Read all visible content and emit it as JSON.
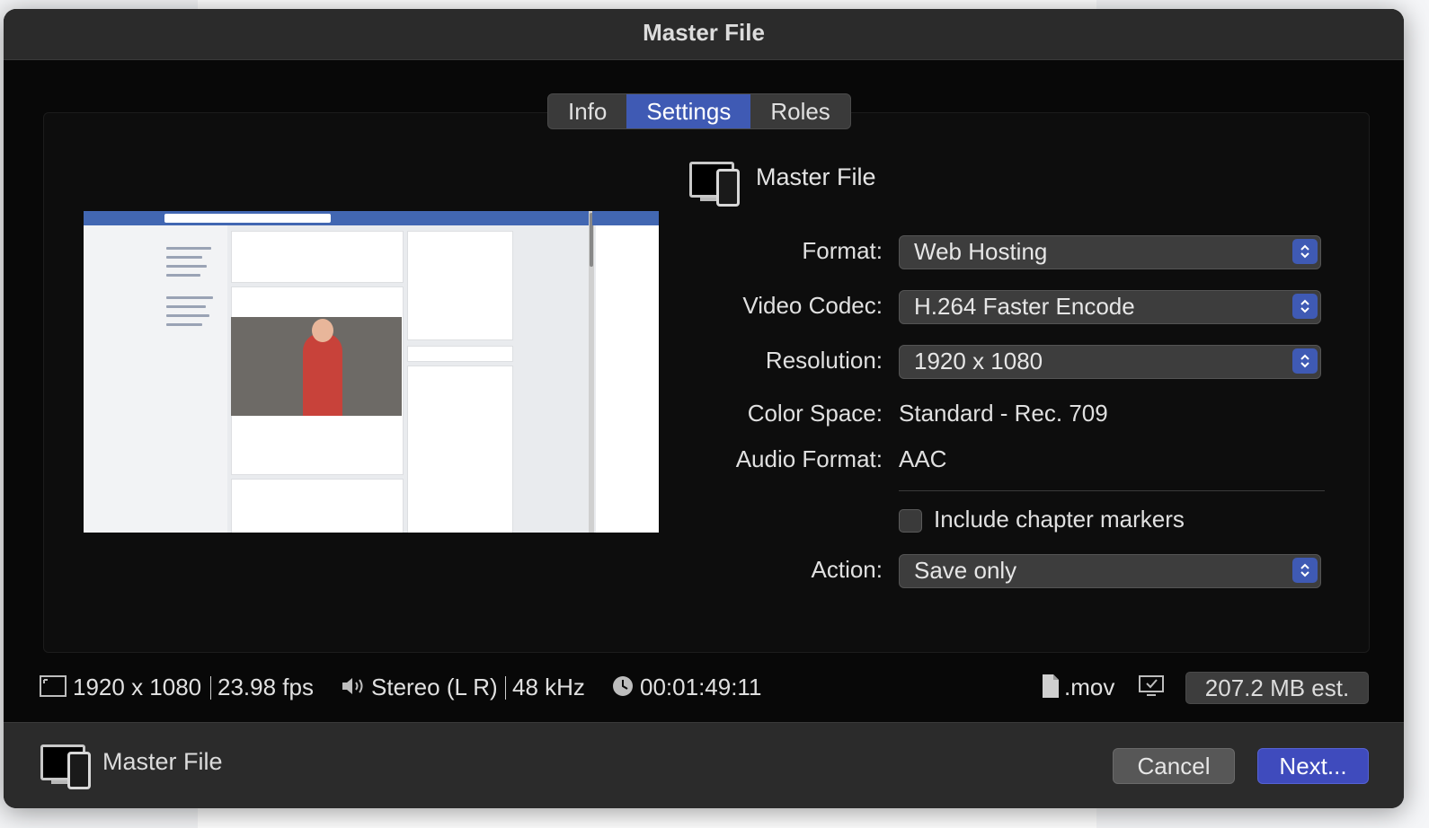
{
  "dialog": {
    "title": "Master File"
  },
  "tabs": [
    {
      "label": "Info",
      "active": false
    },
    {
      "label": "Settings",
      "active": true
    },
    {
      "label": "Roles",
      "active": false
    }
  ],
  "preset": {
    "name": "Master File",
    "icon": "computer-and-phone-icon"
  },
  "settings": {
    "format": {
      "label": "Format:",
      "value": "Web Hosting"
    },
    "video_codec": {
      "label": "Video Codec:",
      "value": "H.264 Faster Encode"
    },
    "resolution": {
      "label": "Resolution:",
      "value": "1920 x 1080"
    },
    "color_space": {
      "label": "Color Space:",
      "value": "Standard - Rec. 709"
    },
    "audio_format": {
      "label": "Audio Format:",
      "value": "AAC"
    },
    "chapter_markers": {
      "label": "Include chapter markers",
      "checked": false
    },
    "action": {
      "label": "Action:",
      "value": "Save only"
    }
  },
  "info_bar": {
    "frame_size": "1920 x 1080",
    "frame_rate": "23.98 fps",
    "audio_channels": "Stereo (L R)",
    "sample_rate": "48 kHz",
    "duration": "00:01:49:11",
    "extension": ".mov",
    "estimated_size": "207.2 MB est."
  },
  "footer": {
    "preset_name": "Master File",
    "cancel_label": "Cancel",
    "next_label": "Next..."
  },
  "colors": {
    "accent": "#3f5ab4",
    "next_button": "#3f4bbd",
    "dialog_bg": "#080808"
  }
}
